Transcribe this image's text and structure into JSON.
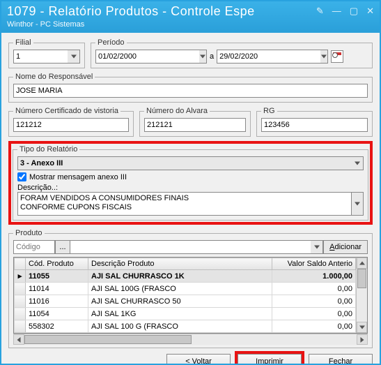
{
  "window": {
    "title": "1079 - Relatório Produtos - Controle Espe",
    "subtitle": "Winthor - PC Sistemas"
  },
  "filial": {
    "legend": "Filial",
    "value": "1"
  },
  "periodo": {
    "legend": "Período",
    "from": "01/02/2000",
    "sep": "a",
    "to": "29/02/2020"
  },
  "responsavel": {
    "legend": "Nome do Responsável",
    "value": "JOSE MARIA"
  },
  "certificado": {
    "legend": "Número Certificado de vistoria",
    "value": "121212"
  },
  "alvara": {
    "legend": "Número do Alvara",
    "value": "212121"
  },
  "rg": {
    "legend": "RG",
    "value": "123456"
  },
  "tipo": {
    "legend": "Tipo do Relatório",
    "value": "3 - Anexo III",
    "checkbox_label": "Mostrar mensagem anexo III",
    "checkbox_checked": true,
    "descricao_label": "Descrição..:",
    "descricao_value": "FORAM VENDIDOS A CONSUMIDORES FINAIS\nCONFORME CUPONS FISCAIS"
  },
  "produto": {
    "legend": "Produto",
    "codigo_placeholder": "Código",
    "ellipsis": "...",
    "adicionar": "Adicionar",
    "columns": {
      "cod": "Cód. Produto",
      "desc": "Descrição Produto",
      "valor": "Valor Saldo Anterio"
    },
    "rows": [
      {
        "cod": "11055",
        "desc": "AJI SAL CHURRASCO 1K",
        "valor": "1.000,00",
        "selected": true
      },
      {
        "cod": "11014",
        "desc": "AJI SAL 100G (FRASCO",
        "valor": "0,00"
      },
      {
        "cod": "11016",
        "desc": "AJI SAL CHURRASCO 50",
        "valor": "0,00"
      },
      {
        "cod": "11054",
        "desc": "AJI SAL 1KG",
        "valor": "0,00"
      },
      {
        "cod": "558302",
        "desc": "AJI SAL 100 G (FRASCO",
        "valor": "0,00"
      }
    ]
  },
  "buttons": {
    "voltar": "< Voltar",
    "imprimir": "Imprimir",
    "fechar": "Fechar"
  }
}
